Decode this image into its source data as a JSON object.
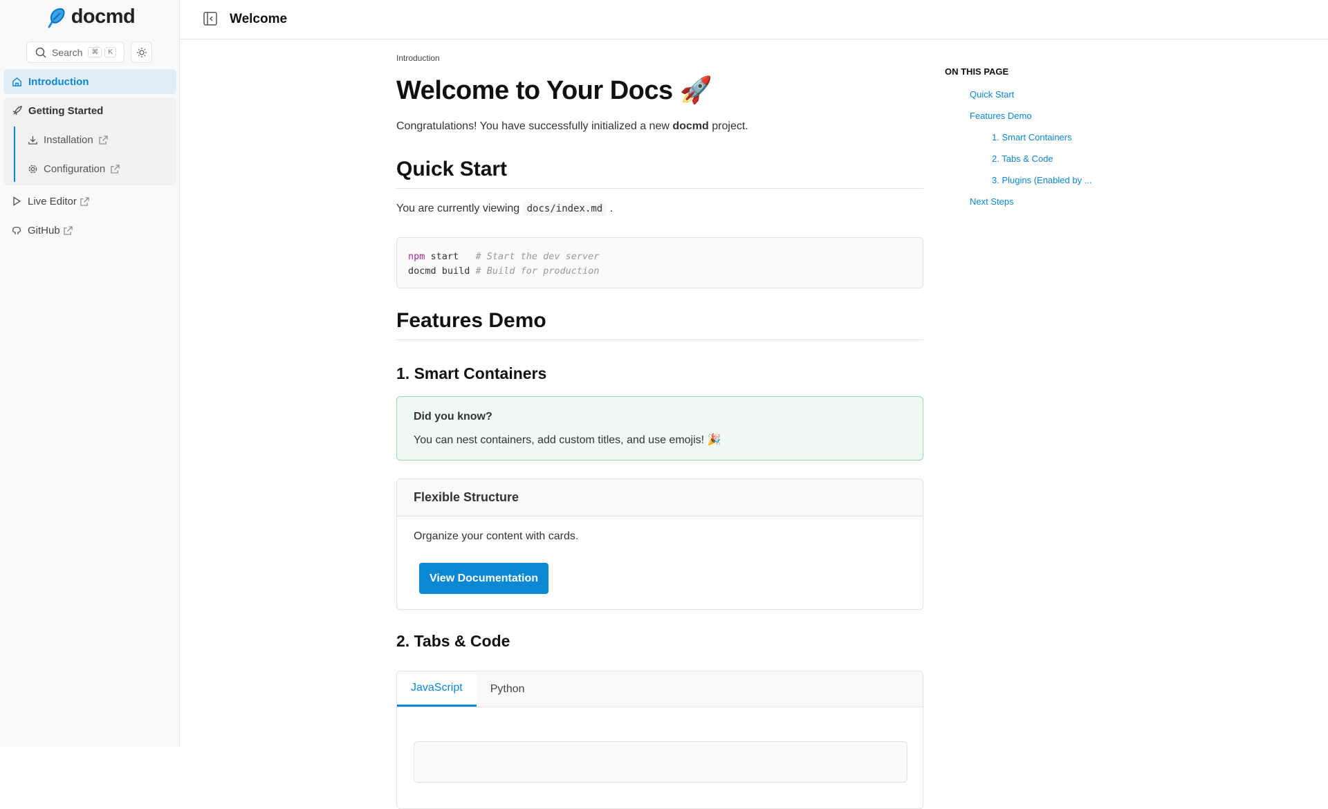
{
  "brand": {
    "name": "docmd",
    "accent": "#0a86d6"
  },
  "search": {
    "placeholder": "Search",
    "shortcut_mod": "⌘",
    "shortcut_key": "K"
  },
  "sidebar": {
    "introduction": "Introduction",
    "getting_started": "Getting Started",
    "installation": "Installation",
    "configuration": "Configuration",
    "live_editor": "Live Editor",
    "github": "GitHub"
  },
  "header": {
    "title": "Welcome"
  },
  "page": {
    "breadcrumb": "Introduction",
    "title": "Welcome to Your Docs 🚀",
    "intro_pre": "Congratulations! You have successfully initialized a new ",
    "intro_bold": "docmd",
    "intro_post": " project.",
    "quick_start": "Quick Start",
    "viewing_pre": "You are currently viewing ",
    "viewing_code": "docs/index.md",
    "viewing_post": " .",
    "code": {
      "l1_kw": "npm",
      "l1_cmd": " start   ",
      "l1_cm": "# Start the dev server",
      "l2_cmd": "docmd build ",
      "l2_cm": "# Build for production"
    },
    "features_demo": "Features Demo",
    "smart_containers": "1. Smart Containers",
    "callout_title": "Did you know?",
    "callout_text": "You can nest containers, add custom titles, and use emojis! 🎉",
    "card_title": "Flexible Structure",
    "card_text": "Organize your content with cards.",
    "card_button": "View Documentation",
    "tabs_code": "2. Tabs & Code",
    "tabs": [
      "JavaScript",
      "Python"
    ]
  },
  "toc": {
    "title": "ON THIS PAGE",
    "items": [
      "Quick Start",
      "Features Demo",
      "1. Smart Containers",
      "2. Tabs & Code",
      "3. Plugins (Enabled by ...",
      "Next Steps"
    ]
  }
}
